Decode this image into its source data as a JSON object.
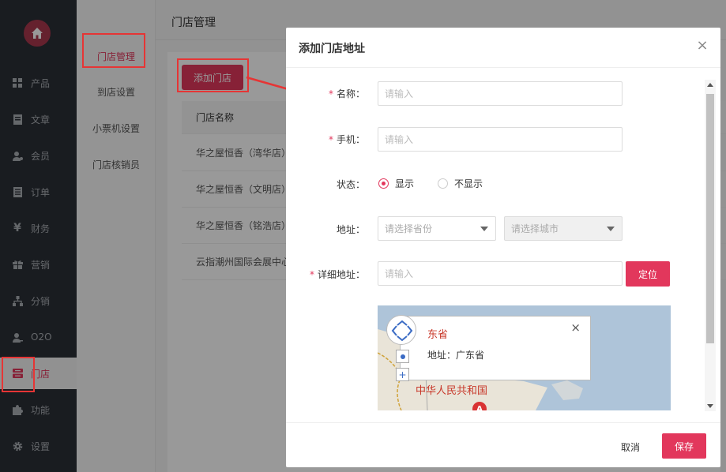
{
  "sidebar": {
    "items": [
      {
        "label": "产品",
        "icon": "grid-icon"
      },
      {
        "label": "文章",
        "icon": "document-icon"
      },
      {
        "label": "会员",
        "icon": "user-icon"
      },
      {
        "label": "订单",
        "icon": "list-icon"
      },
      {
        "label": "财务",
        "icon": "yen-icon",
        "glyph": "¥"
      },
      {
        "label": "营销",
        "icon": "gift-icon"
      },
      {
        "label": "分销",
        "icon": "hierarchy-icon"
      },
      {
        "label": "O2O",
        "icon": "user-plus-icon"
      },
      {
        "label": "门店",
        "icon": "store-icon",
        "active": true
      },
      {
        "label": "功能",
        "icon": "puzzle-icon"
      },
      {
        "label": "设置",
        "icon": "gear-icon"
      }
    ]
  },
  "subnav": {
    "items": [
      "门店管理",
      "到店设置",
      "小票机设置",
      "门店核销员"
    ]
  },
  "main": {
    "title": "门店管理",
    "add_button": "添加门店",
    "table_header": "门店名称",
    "rows": [
      "华之屋恒香（湾华店）",
      "华之屋恒香（文明店）",
      "华之屋恒香（铭浩店）",
      "云指潮州国际会展中心"
    ]
  },
  "modal": {
    "title": "添加门店地址",
    "close_glyph": "×",
    "required_mark": "*",
    "name_label": "名称：",
    "name_placeholder": "请输入",
    "phone_label": "手机：",
    "phone_placeholder": "请输入",
    "status_label": "状态：",
    "status_options": [
      "显示",
      "不显示"
    ],
    "address_label": "地址：",
    "province_placeholder": "请选择省份",
    "city_placeholder": "请选择城市",
    "detail_label": "详细地址：",
    "detail_placeholder": "请输入",
    "locate_button": "定位",
    "map": {
      "popup_title": "东省",
      "popup_address": "地址：广东省",
      "popup_close": "×",
      "country_label": "中华人民共和国",
      "marker": "A",
      "zoom_in": "+"
    },
    "cancel_button": "取消",
    "save_button": "保存"
  },
  "colors": {
    "accent": "#e2375c",
    "sidebar_bg": "#2b2f36",
    "highlight_box": "#e63535"
  }
}
